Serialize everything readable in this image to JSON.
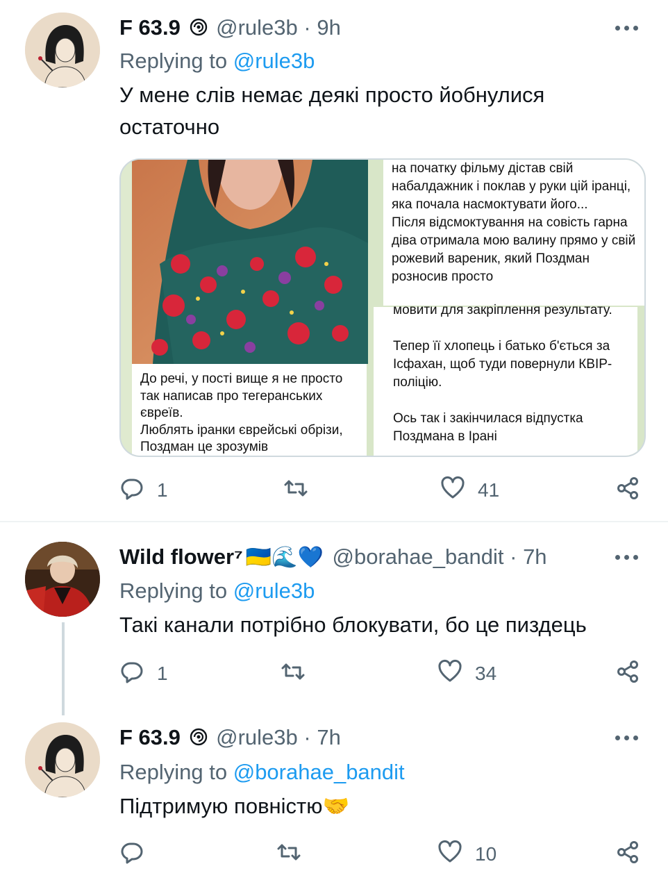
{
  "tweets": [
    {
      "name": "F 63.9",
      "handle": "@rule3b",
      "dot": "·",
      "time": "9h",
      "replying_prefix": "Replying to ",
      "replying_to": "@rule3b",
      "text": "У мене слів немає деякі просто йобнулися остаточно",
      "replies": "1",
      "retweets": "",
      "likes": "41",
      "media": {
        "caption_left": "До речі, у пості вище я не просто так написав про тегеранських євреїв.\nЛюблять іранки єврейські обрізи, Поздман це зрозумів",
        "caption_right_top": "на початку фільму дістав свій набалдажник і поклав у руки цій іранці, яка почала насмоктувати його...\nПісля відсмоктування на совість гарна діва отримала мою валину прямо у свій рожевий вареник, який Поздман розносив просто",
        "caption_right_bottom_1": "мовити для закріплення результату.",
        "caption_right_bottom_2": "Тепер її хлопець і батько б'ється за Ісфахан, щоб туди повернули КВІР-поліцію.",
        "caption_right_bottom_3": "Ось так і закінчилася відпустка Поздмана в Ірані"
      }
    },
    {
      "name": "Wild flower⁷",
      "name_emojis": "🇺🇦🌊💙",
      "handle": "@borahae_bandit",
      "dot": "·",
      "time": "7h",
      "replying_prefix": "Replying to ",
      "replying_to": "@rule3b",
      "text": "Такі канали потрібно блокувати, бо це пиздець",
      "replies": "1",
      "retweets": "",
      "likes": "34"
    },
    {
      "name": "F 63.9",
      "handle": "@rule3b",
      "dot": "·",
      "time": "7h",
      "replying_prefix": "Replying to ",
      "replying_to": "@borahae_bandit",
      "text": "Підтримую повністю🤝",
      "replies": "",
      "retweets": "",
      "likes": "10"
    }
  ],
  "colors": {
    "text": "#0f1419",
    "secondary": "#536471",
    "link": "#1d9bf0",
    "divider": "#eff3f4"
  },
  "icons": [
    "reply-icon",
    "retweet-icon",
    "like-icon",
    "share-icon",
    "more-icon",
    "verified-badge-icon"
  ]
}
